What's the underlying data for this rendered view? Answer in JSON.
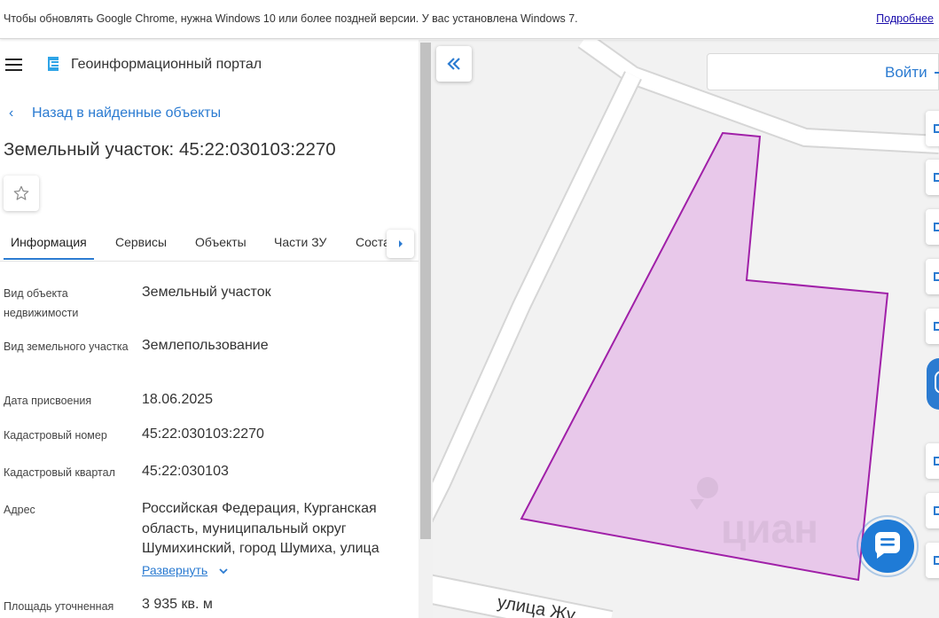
{
  "browser_banner": {
    "message": "Чтобы обновлять Google Chrome, нужна Windows 10 или более поздней версии. У вас установлена Windows 7.",
    "more_link": "Подробнее"
  },
  "header": {
    "menu_icon": "hamburger-icon",
    "logo_icon": "portal-logo-icon",
    "title": "Геоинформационный портал"
  },
  "back_link": {
    "label": "Назад в найденные объекты"
  },
  "page_title": "Земельный участок: 45:22:030103:2270",
  "favorite_icon": "star-icon",
  "tabs": [
    {
      "label": "Информация",
      "active": true
    },
    {
      "label": "Сервисы",
      "active": false
    },
    {
      "label": "Объекты",
      "active": false
    },
    {
      "label": "Части ЗУ",
      "active": false
    },
    {
      "label": "Соста",
      "active": false
    }
  ],
  "details": [
    {
      "label": "Вид объекта недвижимости",
      "value": "Земельный участок"
    },
    {
      "label": "Вид земельного участка",
      "value": "Землепользование"
    },
    {
      "label": "Дата присвоения",
      "value": "18.06.2025"
    },
    {
      "label": "Кадастровый номер",
      "value": "45:22:030103:2270"
    },
    {
      "label": "Кадастровый квартал",
      "value": "45:22:030103"
    },
    {
      "label": "Адрес",
      "value": "Российская Федерация, Курганская область, муниципальный округ Шумихинский, город Шумиха, улица"
    },
    {
      "label": "Площадь уточненная",
      "value": "3 935 кв. м"
    }
  ],
  "expand_link": {
    "label": "Развернуть"
  },
  "map": {
    "street_label": "улица Жу",
    "watermark": "циан",
    "parcel_fill": "#e8c8ea",
    "parcel_stroke": "#a020a8"
  },
  "login": {
    "label": "Войти"
  },
  "colors": {
    "accent": "#2b7bd1"
  }
}
